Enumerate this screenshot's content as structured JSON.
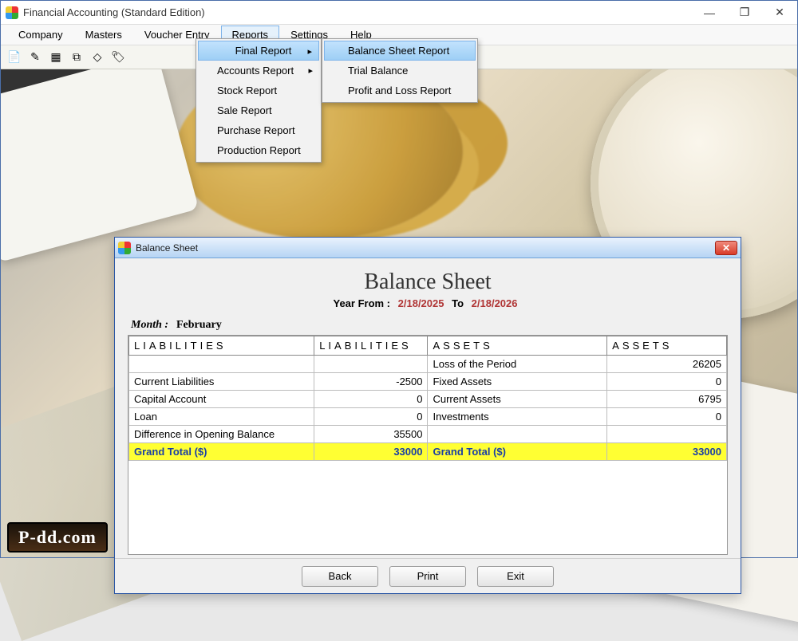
{
  "app": {
    "title": "Financial Accounting (Standard Edition)"
  },
  "menubar": {
    "items": [
      "Company",
      "Masters",
      "Voucher Entry",
      "Reports",
      "Settings",
      "Help"
    ],
    "active_index": 3
  },
  "toolbar_icons": [
    "new-icon",
    "edit-icon",
    "grid-icon",
    "options-icon",
    "print-icon",
    "tag-icon"
  ],
  "reports_menu": {
    "items": [
      {
        "label": "Final Report",
        "sub": true,
        "highlight": true
      },
      {
        "label": "Accounts Report",
        "sub": true
      },
      {
        "label": "Stock Report"
      },
      {
        "label": "Sale Report"
      },
      {
        "label": "Purchase Report"
      },
      {
        "label": "Production Report"
      }
    ]
  },
  "final_report_submenu": {
    "items": [
      {
        "label": "Balance Sheet Report",
        "highlight": true
      },
      {
        "label": "Trial Balance"
      },
      {
        "label": "Profit and Loss Report"
      }
    ]
  },
  "child": {
    "title": "Balance Sheet",
    "heading": "Balance Sheet",
    "range_label_from": "Year From  :",
    "date_from": "2/18/2025",
    "range_label_to": "To",
    "date_to": "2/18/2026",
    "month_label": "Month :",
    "month_value": "February",
    "columns": [
      "LIABILITIES",
      "LIABILITIES",
      "ASSETS",
      "ASSETS"
    ],
    "rows": [
      {
        "l_name": "",
        "l_val": "",
        "a_name": "Loss of the Period",
        "a_val": "26205"
      },
      {
        "l_name": "Current Liabilities",
        "l_val": "-2500",
        "a_name": "Fixed Assets",
        "a_val": "0"
      },
      {
        "l_name": "Capital Account",
        "l_val": "0",
        "a_name": "Current Assets",
        "a_val": "6795"
      },
      {
        "l_name": "Loan",
        "l_val": "0",
        "a_name": "Investments",
        "a_val": "0"
      },
      {
        "l_name": "Difference in Opening Balance",
        "l_val": "35500",
        "a_name": "",
        "a_val": ""
      }
    ],
    "total": {
      "l_name": "Grand Total ($)",
      "l_val": "33000",
      "a_name": "Grand Total ($)",
      "a_val": "33000"
    },
    "buttons": {
      "back": "Back",
      "print": "Print",
      "exit": "Exit"
    }
  },
  "watermark": "P-dd.com"
}
